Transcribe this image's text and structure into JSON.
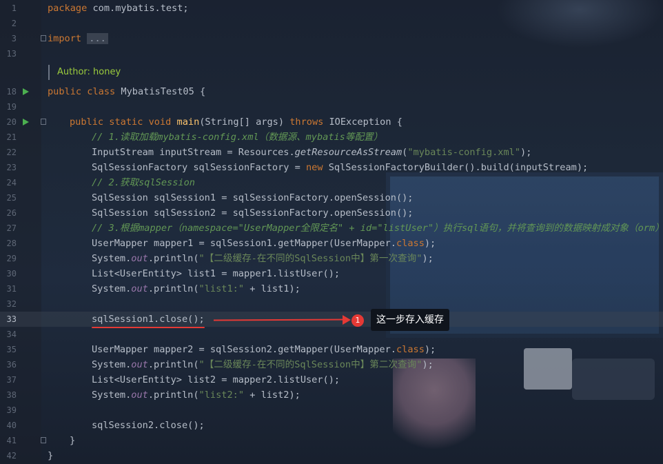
{
  "line_numbers": [
    "1",
    "2",
    "3",
    "13",
    "",
    "18",
    "19",
    "20",
    "21",
    "22",
    "23",
    "24",
    "25",
    "26",
    "27",
    "28",
    "29",
    "30",
    "31",
    "32",
    "33",
    "34",
    "35",
    "36",
    "37",
    "38",
    "39",
    "40",
    "41",
    "42"
  ],
  "author_hint": "Author: honey",
  "code": {
    "l1_kw": "package",
    "l1_rest": " com.mybatis.test;",
    "l3_kw": "import",
    "l3_fold": "...",
    "l18_kw": "public class",
    "l18_rest": " MybatisTest05 {",
    "l20_kw1": "public static void",
    "l20_fn": " main",
    "l20_mid": "(String[] args) ",
    "l20_kw2": "throws",
    "l20_rest": " IOException {",
    "l21_cm": "// 1.读取加载mybatis-config.xml（数据源、mybatis等配置）",
    "l22_a": "InputStream inputStream = Resources.",
    "l22_it": "getResourceAsStream",
    "l22_b": "(",
    "l22_st": "\"mybatis-config.xml\"",
    "l22_c": ");",
    "l23_a": "SqlSessionFactory sqlSessionFactory = ",
    "l23_kw": "new",
    "l23_b": " SqlSessionFactoryBuilder().build(inputStream);",
    "l24_cm": "// 2.获取sqlSession",
    "l25": "SqlSession sqlSession1 = sqlSessionFactory.openSession();",
    "l26": "SqlSession sqlSession2 = sqlSessionFactory.openSession();",
    "l27_cm": "// 3.根据mapper（namespace=\"UserMapper全限定名\" + id=\"listUser\"）执行sql语句，并将查询到的数据映射成对象（orm）",
    "l28_a": "UserMapper mapper1 = sqlSession1.getMapper(UserMapper.",
    "l28_kw": "class",
    "l28_b": ");",
    "l29_a": "System.",
    "l29_pf": "out",
    "l29_b": ".println(",
    "l29_st": "\"【二级缓存-在不同的SqlSession中】第一次查询\"",
    "l29_c": ");",
    "l30": "List<UserEntity> list1 = mapper1.listUser();",
    "l31_a": "System.",
    "l31_pf": "out",
    "l31_b": ".println(",
    "l31_st": "\"list1:\"",
    "l31_c": " + list1);",
    "l33": "sqlSession1.close();",
    "l35_a": "UserMapper mapper2 = sqlSession2.getMapper(UserMapper.",
    "l35_kw": "class",
    "l35_b": ");",
    "l36_a": "System.",
    "l36_pf": "out",
    "l36_b": ".println(",
    "l36_st": "\"【二级缓存-在不同的SqlSession中】第二次查询\"",
    "l36_c": ");",
    "l37": "List<UserEntity> list2 = mapper2.listUser();",
    "l38_a": "System.",
    "l38_pf": "out",
    "l38_b": ".println(",
    "l38_st": "\"list2:\"",
    "l38_c": " + list2);",
    "l40": "sqlSession2.close();",
    "l41": "}",
    "l42": "}"
  },
  "annotation": {
    "badge_number": "1",
    "callout_text": "这一步存入缓存",
    "color": "#e53935"
  },
  "colors": {
    "keyword": "#cc7832",
    "method": "#ffc66d",
    "string": "#6a8759",
    "comment": "#629755",
    "static_field": "#9876aa",
    "hint": "#9ccc3d",
    "run_icon": "#4caf50"
  }
}
